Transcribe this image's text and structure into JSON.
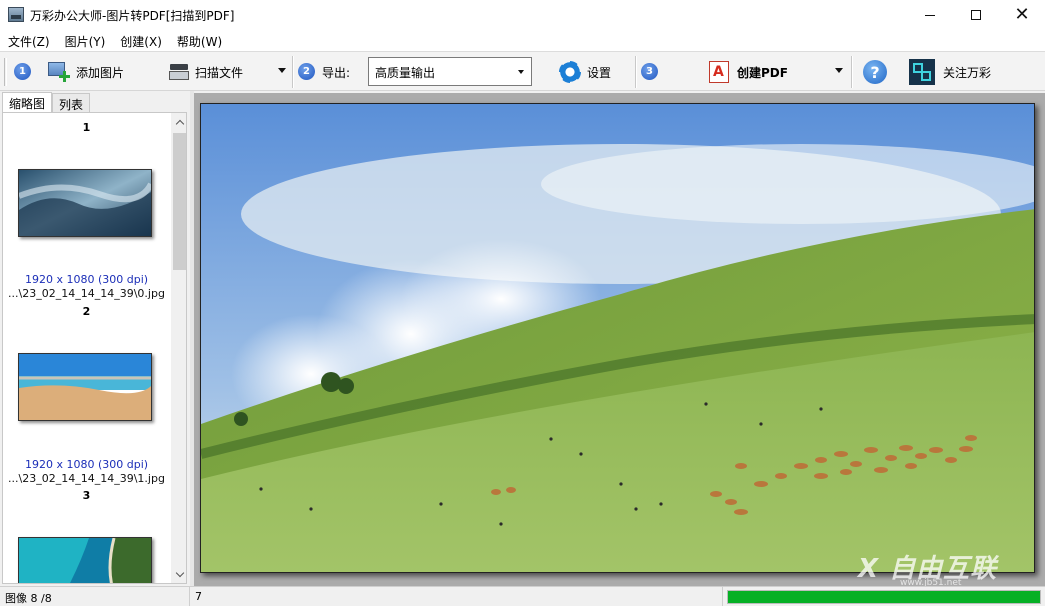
{
  "window": {
    "title": "万彩办公大师-图片转PDF[扫描到PDF]",
    "icon": "app-image-icon"
  },
  "menu": [
    "文件(Z)",
    "图片(Y)",
    "创建(X)",
    "帮助(W)"
  ],
  "toolbar": {
    "step1": "1",
    "add_image": "添加图片",
    "scan_file": "扫描文件",
    "step2": "2",
    "export_label": "导出:",
    "export_value": "高质量输出",
    "settings": "设置",
    "step3": "3",
    "create_pdf": "创建PDF",
    "help": "?",
    "follow": "关注万彩"
  },
  "tabs": [
    "缩略图",
    "列表"
  ],
  "thumbnails": [
    {
      "index": "1",
      "dims": "1920 x 1080 (300 dpi)",
      "path": "...\\23_02_14_14_14_39\\0.jpg"
    },
    {
      "index": "2",
      "dims": "1920 x 1080 (300 dpi)",
      "path": "...\\23_02_14_14_14_39\\1.jpg"
    },
    {
      "index": "3"
    }
  ],
  "status": {
    "images": "图像 8 /8",
    "current": "7",
    "progress_percent": 100
  },
  "watermark": {
    "text": "X 自由互联",
    "sub": "www.jb51.net"
  },
  "colors": {
    "progress": "#06b025",
    "dims_text": "#1c2fb8",
    "step_badge": "#1f56c0"
  }
}
